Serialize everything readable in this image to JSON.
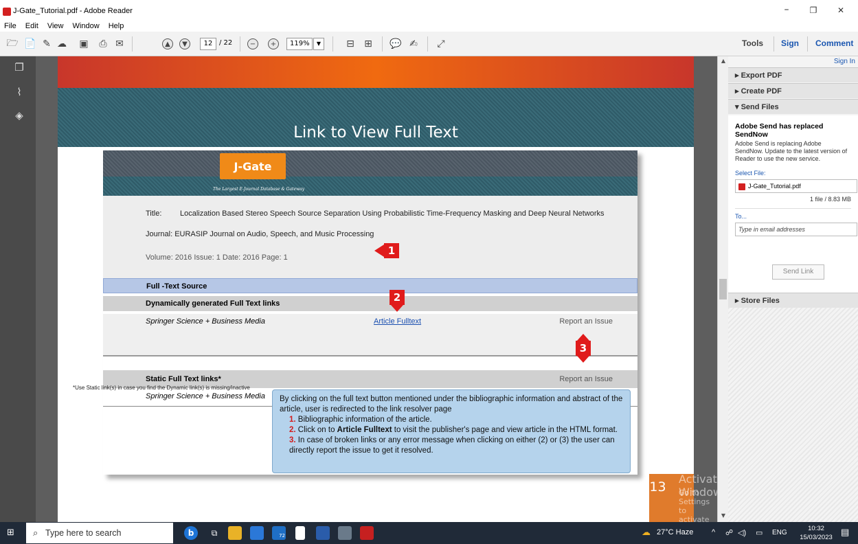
{
  "window": {
    "title": "J-Gate_Tutorial.pdf - Adobe Reader",
    "minimize": "–",
    "restore": "❐",
    "close": "✕"
  },
  "menu": [
    "File",
    "Edit",
    "View",
    "Window",
    "Help"
  ],
  "toolbar": {
    "page_current": "12",
    "page_total": "/ 22",
    "zoom": "119%",
    "zoom_arrow": "▼",
    "tools": "Tools",
    "sign": "Sign",
    "comment": "Comment"
  },
  "slide": {
    "heading": "Link to View Full Text",
    "logo_text": "J-Gate",
    "logo_tagline": "The Largest E-Journal Database & Gateway",
    "title_label": "Title:",
    "title_value": "Localization Based Stereo Speech Source Separation Using Probabilistic Time-Frequency Masking and Deep Neural Networks",
    "journal": "Journal:  EURASIP Journal on Audio, Speech, and Music Processing",
    "volume_line": "Volume: 2016   Issue: 1    Date: 2016   Page: 1",
    "fulltext_source": "Full -Text Source",
    "dynamic_header": "Dynamically generated Full Text links",
    "publisher": "Springer Science + Business Media",
    "article_fulltext": "Article Fulltext",
    "report_issue": "Report an Issue",
    "static_header": "Static Full Text links*",
    "report_issue_2": "Report an Issue",
    "publisher_2": "Springer Science + Business Media",
    "footnote": "*Use Static link(s) in case you find the Dynamic link(s) is missing/inactive",
    "markers": [
      "1",
      "2",
      "3"
    ],
    "callout": {
      "intro": "By clicking on the full text button mentioned under the bibliographic information and abstract of the article, user is redirected to the link resolver page",
      "items": [
        {
          "num": "1.",
          "pre": " Bibliographic information of the article.",
          "bold": "",
          "post": ""
        },
        {
          "num": "2.",
          "pre": " Click on to ",
          "bold": "Article Fulltext",
          "post": " to visit the publisher's page and view article in the HTML format."
        },
        {
          "num": "3.",
          "pre": "  In case of broken links or any error message when clicking on either (2) or (3) the user can directly report the issue to get it resolved.",
          "bold": "",
          "post": ""
        }
      ]
    },
    "page_number": "13"
  },
  "watermark": {
    "line1": "Activate Windows",
    "line2": "Go to Settings to activate Windows."
  },
  "right_pane": {
    "sign_in": "Sign In",
    "export_pdf": "▸  Export PDF",
    "create_pdf": "▸  Create PDF",
    "send_files": "▾  Send Files",
    "send_heading": "Adobe Send has replaced SendNow",
    "send_desc": "Adobe Send is replacing Adobe SendNow. Update to the latest version of Reader to use the new service.",
    "select_file": "Select File:",
    "file_name": "J-Gate_Tutorial.pdf",
    "file_count": "1 file / 8.83 MB",
    "to_label": "To...",
    "email_placeholder": "Type in email addresses",
    "send_link": "Send Link",
    "store_files": "▸  Store Files"
  },
  "taskbar": {
    "search_placeholder": "Type here to search",
    "weather": "27°C  Haze",
    "lang": "ENG",
    "time": "10:32",
    "date": "15/03/2023",
    "badge": "72"
  }
}
